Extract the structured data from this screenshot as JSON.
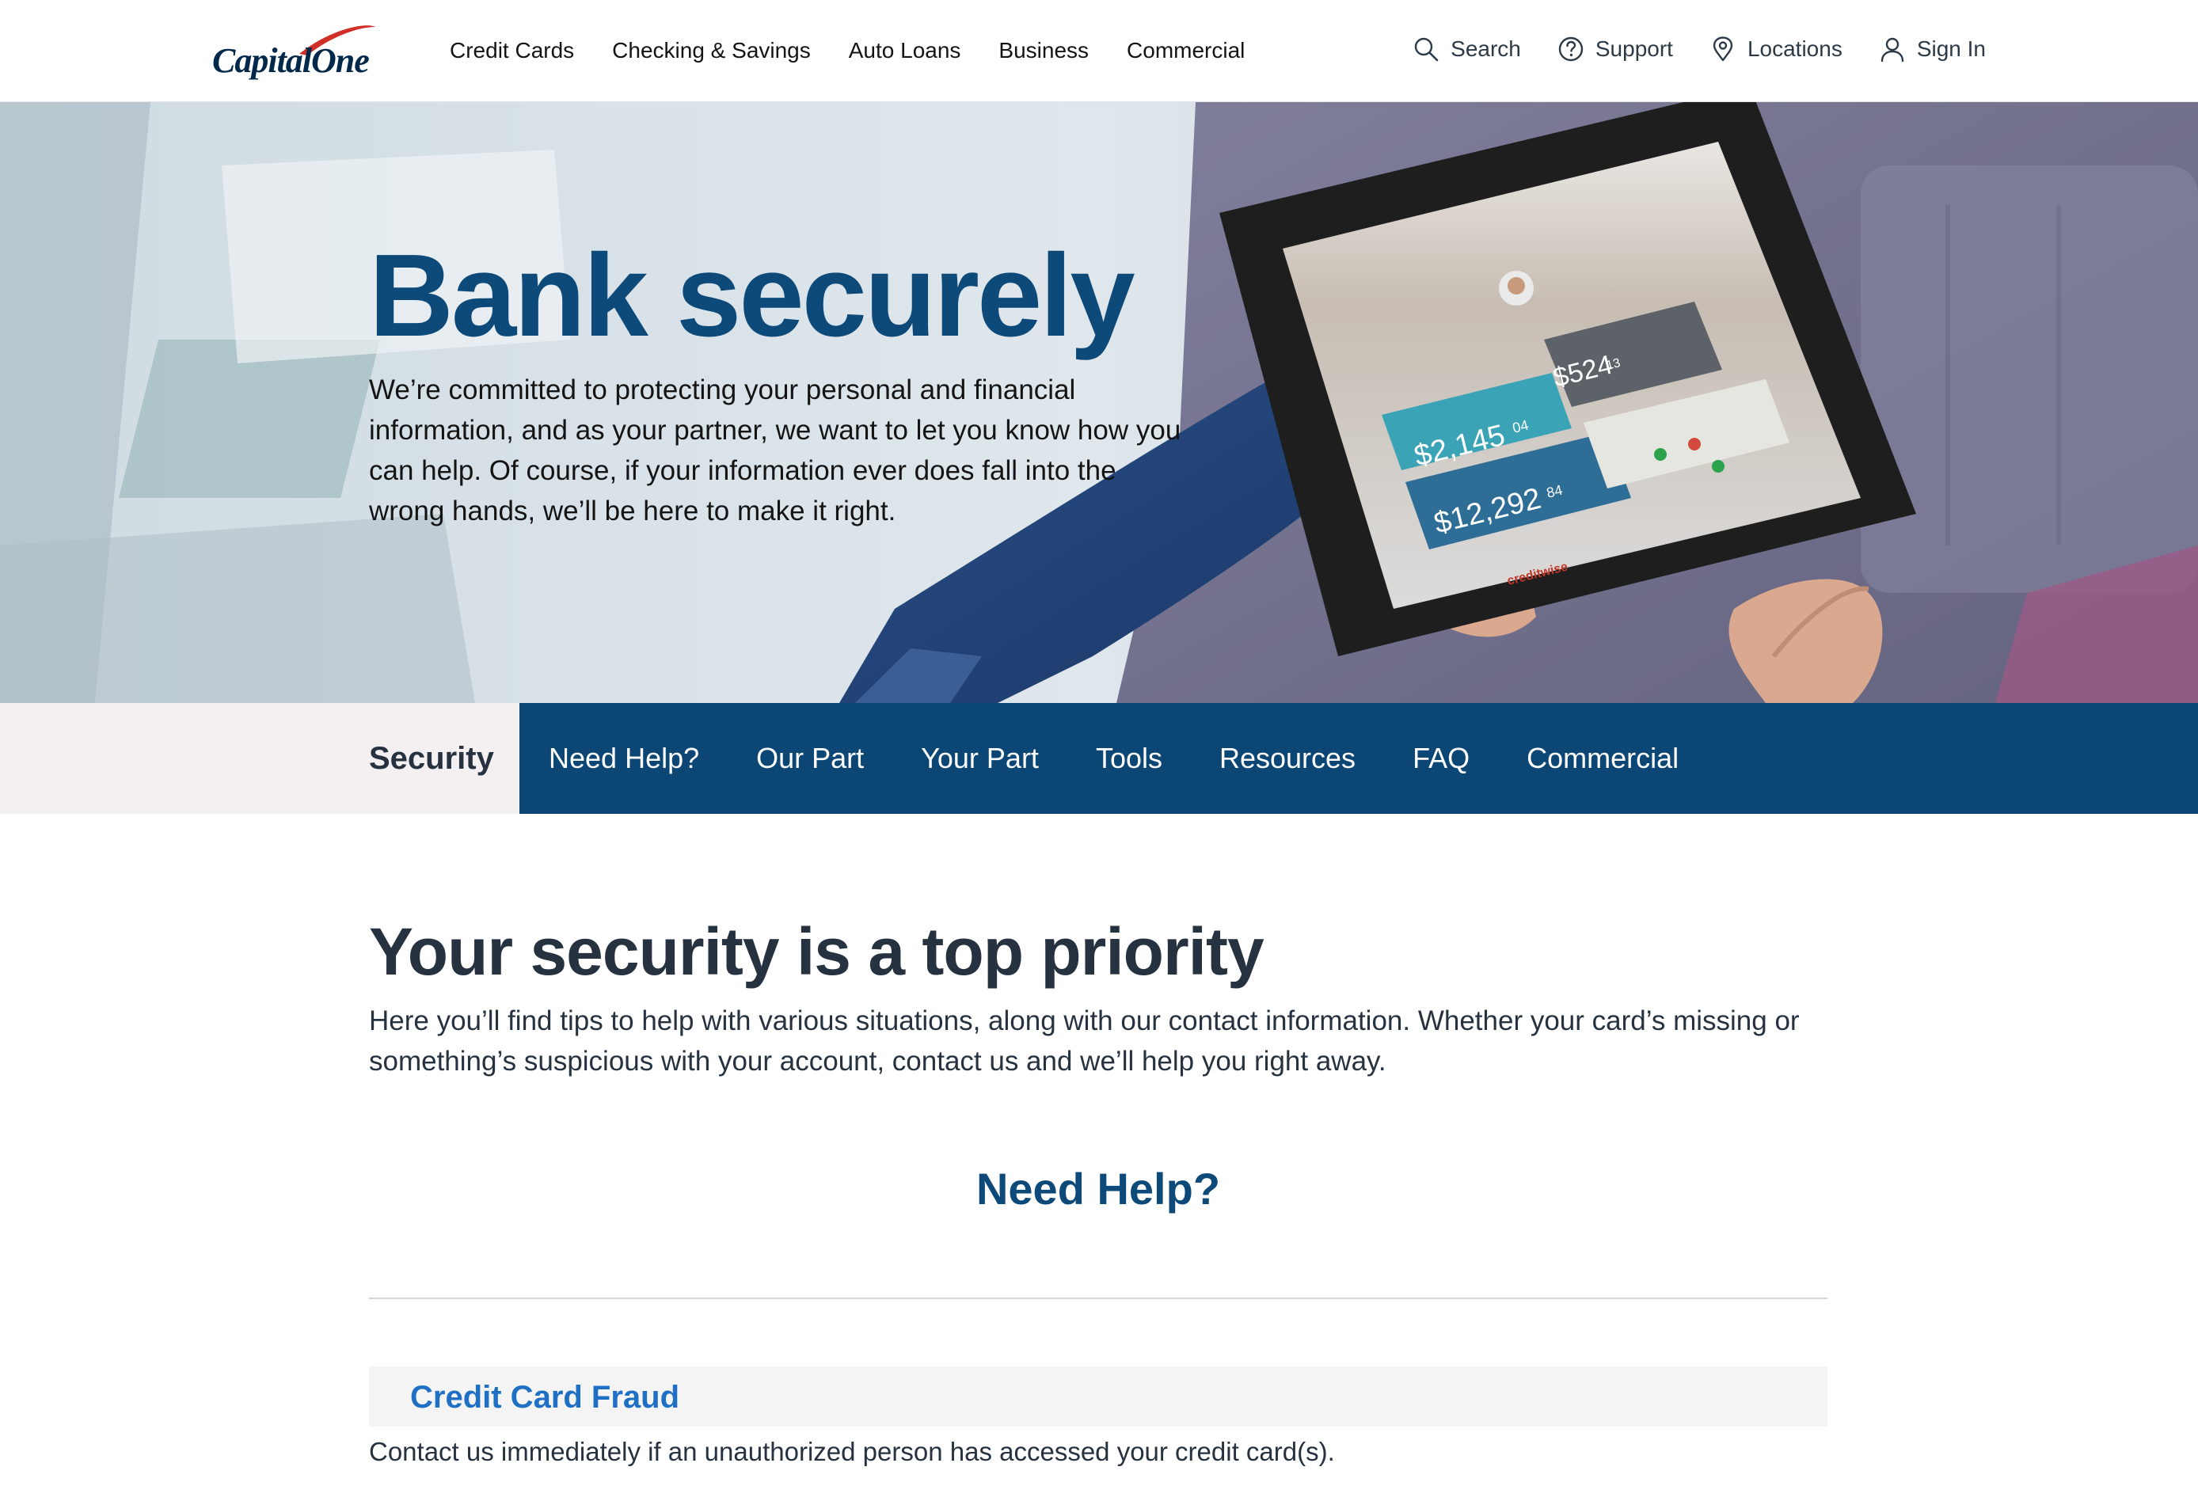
{
  "brand": {
    "logo_text": "CapitalOne",
    "logo_swoosh_color": "#d03027",
    "primary_color": "#0b4675"
  },
  "main_nav": [
    {
      "label": "Credit Cards"
    },
    {
      "label": "Checking & Savings"
    },
    {
      "label": "Auto Loans"
    },
    {
      "label": "Business"
    },
    {
      "label": "Commercial"
    }
  ],
  "utility_nav": {
    "search": {
      "label": "Search",
      "icon": "search-icon"
    },
    "support": {
      "label": "Support",
      "icon": "help-circle-icon"
    },
    "locations": {
      "label": "Locations",
      "icon": "map-pin-icon"
    },
    "sign_in": {
      "label": "Sign In",
      "icon": "user-icon"
    }
  },
  "hero": {
    "title": "Bank securely",
    "text": "We’re committed to protecting your personal and financial information, and as your partner, we want to let you know how you can help. Of course, if your information ever does fall into the wrong hands, we’ll be here to make it right.",
    "image": "person-holding-tablet-photo",
    "tablet_screen": {
      "checking_value": "$2,145",
      "checking_cents": "04",
      "savings_value": "$12,292",
      "savings_cents": "84",
      "card_value": "$524",
      "card_cents": "13",
      "brand": "creditwise"
    }
  },
  "subnav": {
    "active": "Security",
    "items": [
      {
        "label": "Need Help?"
      },
      {
        "label": "Our Part"
      },
      {
        "label": "Your Part"
      },
      {
        "label": "Tools"
      },
      {
        "label": "Resources"
      },
      {
        "label": "FAQ"
      },
      {
        "label": "Commercial"
      }
    ]
  },
  "section": {
    "title": "Your security is a top priority",
    "text": "Here you’ll find tips to help with various situations, along with our contact information. Whether your card’s missing or something’s suspicious with your account, contact us and we’ll help you right away."
  },
  "need_help": {
    "title": "Need Help?",
    "accordion": [
      {
        "title": "Credit Card Fraud",
        "text": "Contact us immediately if an unauthorized person has accessed your credit card(s)."
      }
    ]
  }
}
